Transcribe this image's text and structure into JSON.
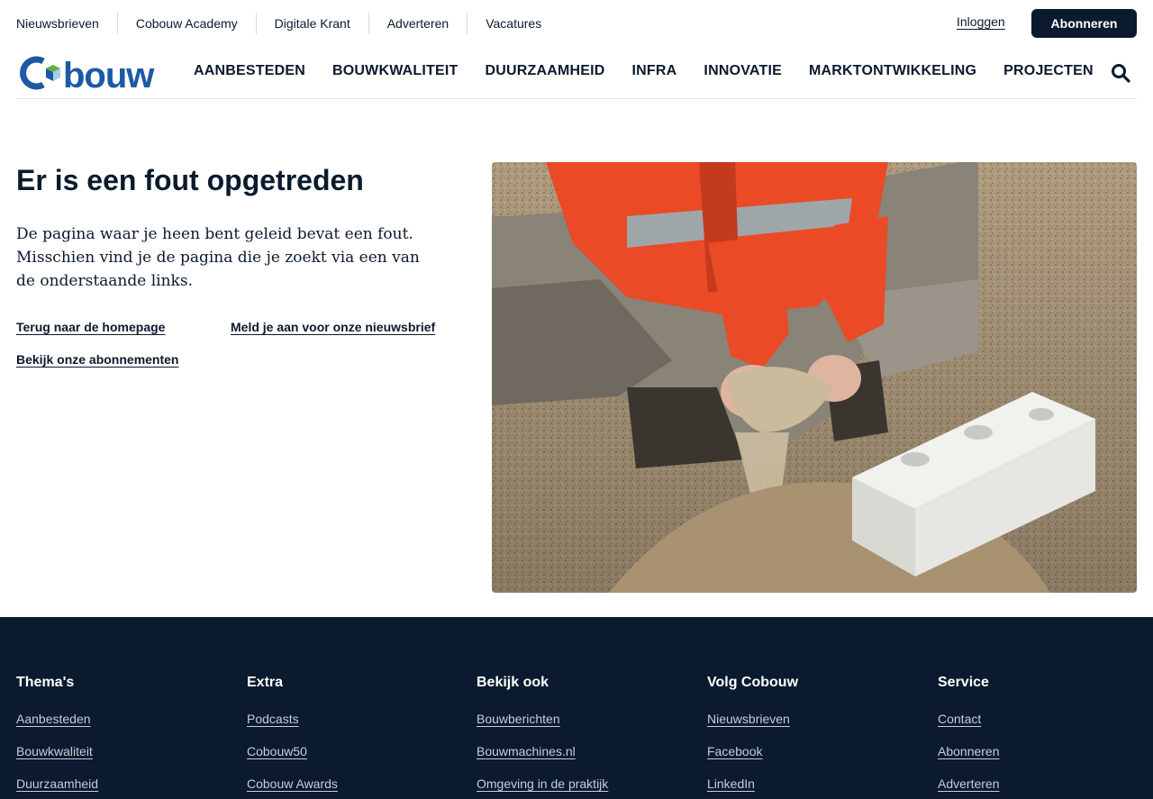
{
  "topbar": {
    "links": [
      "Nieuwsbrieven",
      "Cobouw Academy",
      "Digitale Krant",
      "Adverteren",
      "Vacatures"
    ],
    "login_label": "Inloggen",
    "subscribe_label": "Abonneren"
  },
  "brand": {
    "logo_text": "Cobouw",
    "primary_color": "#1c5aa6",
    "accent_color": "#5fb23b",
    "dark_color": "#0b1a2e"
  },
  "nav": {
    "items": [
      "AANBESTEDEN",
      "BOUWKWALITEIT",
      "DUURZAAMHEID",
      "INFRA",
      "INNOVATIE",
      "MARKTONTWIKKELING",
      "PROJECTEN"
    ],
    "search_icon": "search-icon"
  },
  "error": {
    "title": "Er is een fout opgetreden",
    "message": "De pagina waar je heen bent geleid bevat een fout. Misschien vind je de pagina die je zoekt via een van de onderstaande links.",
    "links": {
      "homepage": "Terug naar de homepage",
      "newsletter": "Meld je aan voor onze nieuwsbrief",
      "subscriptions": "Bekijk onze abonnementen"
    }
  },
  "hero_image": "construction-worker-sand-and-concrete-block-photo",
  "footer": {
    "columns": [
      {
        "title": "Thema's",
        "links": [
          "Aanbesteden",
          "Bouwkwaliteit",
          "Duurzaamheid"
        ]
      },
      {
        "title": "Extra",
        "links": [
          "Podcasts",
          "Cobouw50",
          "Cobouw Awards"
        ]
      },
      {
        "title": "Bekijk ook",
        "links": [
          "Bouwberichten",
          "Bouwmachines.nl",
          "Omgeving in de praktijk"
        ]
      },
      {
        "title": "Volg Cobouw",
        "links": [
          "Nieuwsbrieven",
          "Facebook",
          "LinkedIn"
        ]
      },
      {
        "title": "Service",
        "links": [
          "Contact",
          "Abonneren",
          "Adverteren"
        ]
      }
    ]
  }
}
